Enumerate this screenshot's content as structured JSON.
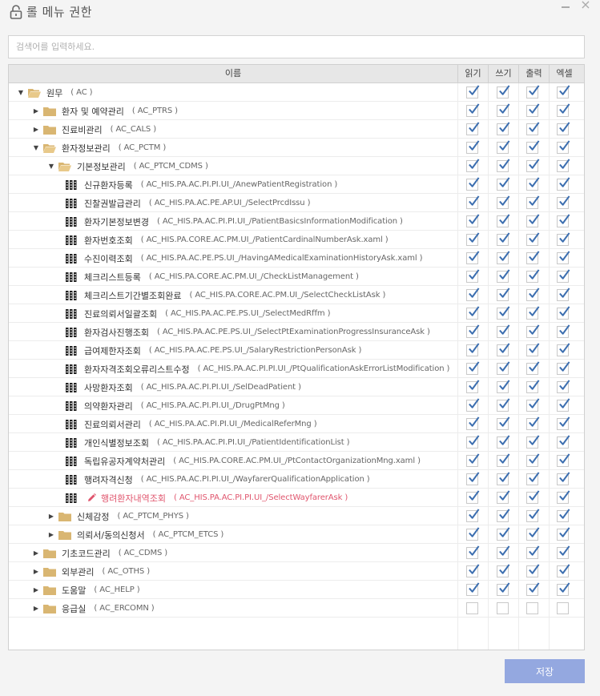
{
  "window": {
    "title": "롤 메뉴 권한"
  },
  "search": {
    "placeholder": "검색어를 입력하세요.",
    "value": ""
  },
  "columns": {
    "name": "이름",
    "read": "읽기",
    "write": "쓰기",
    "print": "출력",
    "excel": "엑셀"
  },
  "rows": [
    {
      "level": 0,
      "type": "folder",
      "expanded": true,
      "label": "원무",
      "code": "( AC )",
      "checked": [
        true,
        true,
        true,
        true
      ]
    },
    {
      "level": 1,
      "type": "folder",
      "expanded": false,
      "label": "환자 및 예약관리",
      "code": "( AC_PTRS )",
      "checked": [
        true,
        true,
        true,
        true
      ]
    },
    {
      "level": 1,
      "type": "folder",
      "expanded": false,
      "label": "진료비관리",
      "code": "( AC_CALS )",
      "checked": [
        true,
        true,
        true,
        true
      ]
    },
    {
      "level": 1,
      "type": "folder",
      "expanded": true,
      "label": "환자정보관리",
      "code": "( AC_PCTM )",
      "checked": [
        true,
        true,
        true,
        true
      ]
    },
    {
      "level": 2,
      "type": "folder",
      "expanded": true,
      "label": "기본정보관리",
      "code": "( AC_PTCM_CDMS )",
      "checked": [
        true,
        true,
        true,
        true
      ]
    },
    {
      "level": 3,
      "type": "program",
      "label": "신규환자등록",
      "code": "( AC_HIS.PA.AC.PI.PI.UI_/AnewPatientRegistration )",
      "checked": [
        true,
        true,
        true,
        true
      ]
    },
    {
      "level": 3,
      "type": "program",
      "label": "진찰권발급관리",
      "code": "( AC_HIS.PA.AC.PE.AP.UI_/SelectPrcdIssu )",
      "checked": [
        true,
        true,
        true,
        true
      ]
    },
    {
      "level": 3,
      "type": "program",
      "label": "환자기본정보변경",
      "code": "( AC_HIS.PA.AC.PI.PI.UI_/PatientBasicsInformationModification )",
      "checked": [
        true,
        true,
        true,
        true
      ]
    },
    {
      "level": 3,
      "type": "program",
      "label": "환자번호조회",
      "code": "( AC_HIS.PA.CORE.AC.PM.UI_/PatientCardinalNumberAsk.xaml )",
      "checked": [
        true,
        true,
        true,
        true
      ]
    },
    {
      "level": 3,
      "type": "program",
      "label": "수진이력조회",
      "code": "( AC_HIS.PA.AC.PE.PS.UI_/HavingAMedicalExaminationHistoryAsk.xaml )",
      "checked": [
        true,
        true,
        true,
        true
      ]
    },
    {
      "level": 3,
      "type": "program",
      "label": "체크리스트등록",
      "code": "( AC_HIS.PA.CORE.AC.PM.UI_/CheckListManagement )",
      "checked": [
        true,
        true,
        true,
        true
      ]
    },
    {
      "level": 3,
      "type": "program",
      "label": "체크리스트기간별조회완료",
      "code": "( AC_HIS.PA.CORE.AC.PM.UI_/SelectCheckListAsk )",
      "checked": [
        true,
        true,
        true,
        true
      ]
    },
    {
      "level": 3,
      "type": "program",
      "label": "진료의뢰서일괄조회",
      "code": "( AC_HIS.PA.AC.PE.PS.UI_/SelectMedRffm )",
      "checked": [
        true,
        true,
        true,
        true
      ]
    },
    {
      "level": 3,
      "type": "program",
      "label": "환자검사진행조회",
      "code": "( AC_HIS.PA.AC.PE.PS.UI_/SelectPtExaminationProgressInsuranceAsk )",
      "checked": [
        true,
        true,
        true,
        true
      ]
    },
    {
      "level": 3,
      "type": "program",
      "label": "급여제한자조회",
      "code": "( AC_HIS.PA.AC.PE.PS.UI_/SalaryRestrictionPersonAsk )",
      "checked": [
        true,
        true,
        true,
        true
      ]
    },
    {
      "level": 3,
      "type": "program",
      "label": "환자자격조회오류리스트수정",
      "code": "( AC_HIS.PA.AC.PI.PI.UI_/PtQualificationAskErrorListModification )",
      "checked": [
        true,
        true,
        true,
        true
      ]
    },
    {
      "level": 3,
      "type": "program",
      "label": "사망환자조회",
      "code": "( AC_HIS.PA.AC.PI.PI.UI_/SelDeadPatient )",
      "checked": [
        true,
        true,
        true,
        true
      ]
    },
    {
      "level": 3,
      "type": "program",
      "label": "의약환자관리",
      "code": "( AC_HIS.PA.AC.PI.PI.UI_/DrugPtMng )",
      "checked": [
        true,
        true,
        true,
        true
      ]
    },
    {
      "level": 3,
      "type": "program",
      "label": "진료의뢰서관리",
      "code": "( AC_HIS.PA.AC.PI.PI.UI_/MedicalReferMng )",
      "checked": [
        true,
        true,
        true,
        true
      ]
    },
    {
      "level": 3,
      "type": "program",
      "label": "개인식별정보조회",
      "code": "( AC_HIS.PA.AC.PI.PI.UI_/PatientIdentificationList )",
      "checked": [
        true,
        true,
        true,
        true
      ]
    },
    {
      "level": 3,
      "type": "program",
      "label": "독립유공자계약처관리",
      "code": "( AC_HIS.PA.CORE.AC.PM.UI_/PtContactOrganizationMng.xaml )",
      "checked": [
        true,
        true,
        true,
        true
      ]
    },
    {
      "level": 3,
      "type": "program",
      "label": "행려자격신청",
      "code": "( AC_HIS.PA.AC.PI.PI.UI_/WayfarerQualificationApplication )",
      "checked": [
        true,
        true,
        true,
        true
      ]
    },
    {
      "level": 3,
      "type": "program",
      "selected": true,
      "label": "행려환자내역조회",
      "code": "( AC_HIS.PA.AC.PI.PI.UI_/SelectWayfarerAsk )",
      "checked": [
        true,
        true,
        true,
        true
      ]
    },
    {
      "level": 2,
      "type": "folder",
      "expanded": false,
      "label": "신체감정",
      "code": "( AC_PTCM_PHYS )",
      "checked": [
        true,
        true,
        true,
        true
      ]
    },
    {
      "level": 2,
      "type": "folder",
      "expanded": false,
      "label": "의뢰서/동의신청서",
      "code": "( AC_PTCM_ETCS )",
      "checked": [
        true,
        true,
        true,
        true
      ]
    },
    {
      "level": 1,
      "type": "folder",
      "expanded": false,
      "label": "기초코드관리",
      "code": "( AC_CDMS )",
      "checked": [
        true,
        true,
        true,
        true
      ]
    },
    {
      "level": 1,
      "type": "folder",
      "expanded": false,
      "label": "외부관리",
      "code": "( AC_OTHS )",
      "checked": [
        true,
        true,
        true,
        true
      ]
    },
    {
      "level": 1,
      "type": "folder",
      "expanded": false,
      "label": "도움말",
      "code": "( AC_HELP )",
      "checked": [
        true,
        true,
        true,
        true
      ]
    },
    {
      "level": 1,
      "type": "folder",
      "expanded": false,
      "label": "응급실",
      "code": "( AC_ERCOMN )",
      "checked": [
        false,
        false,
        false,
        false
      ]
    }
  ],
  "footer": {
    "save_label": "저장"
  },
  "colors": {
    "accent": "#94a8e0",
    "check": "#3d6fb0",
    "folder": "#d9b672",
    "selected_text": "#e0556d"
  }
}
